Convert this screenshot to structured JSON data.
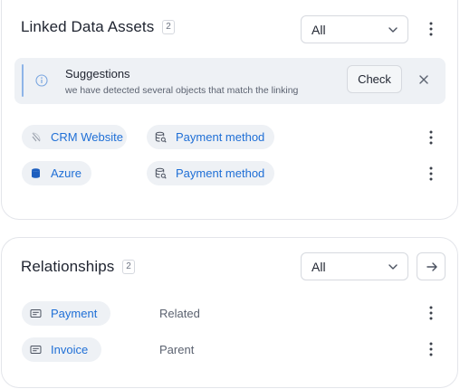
{
  "linked_assets": {
    "title": "Linked Data Assets",
    "count": "2",
    "filter": {
      "selected": "All"
    },
    "suggestion": {
      "title": "Suggestions",
      "body": "we have detected several objects that match the linking",
      "check_label": "Check"
    },
    "rows": [
      {
        "source": "CRM Website",
        "source_icon": "website-icon",
        "target": "Payment method",
        "target_icon": "database-search-icon"
      },
      {
        "source": "Azure",
        "source_icon": "azure-db-icon",
        "target": "Payment method",
        "target_icon": "database-search-icon"
      }
    ]
  },
  "relationships": {
    "title": "Relationships",
    "count": "2",
    "filter": {
      "selected": "All"
    },
    "rows": [
      {
        "entity": "Payment",
        "entity_icon": "entity-card-icon",
        "relation": "Related"
      },
      {
        "entity": "Invoice",
        "entity_icon": "entity-card-icon",
        "relation": "Parent"
      }
    ]
  },
  "colors": {
    "link_blue": "#1f6fd6",
    "chip_bg": "#eef1f5",
    "suggestion_accent": "#8db4e8",
    "azure_blue": "#1e5fbf"
  }
}
